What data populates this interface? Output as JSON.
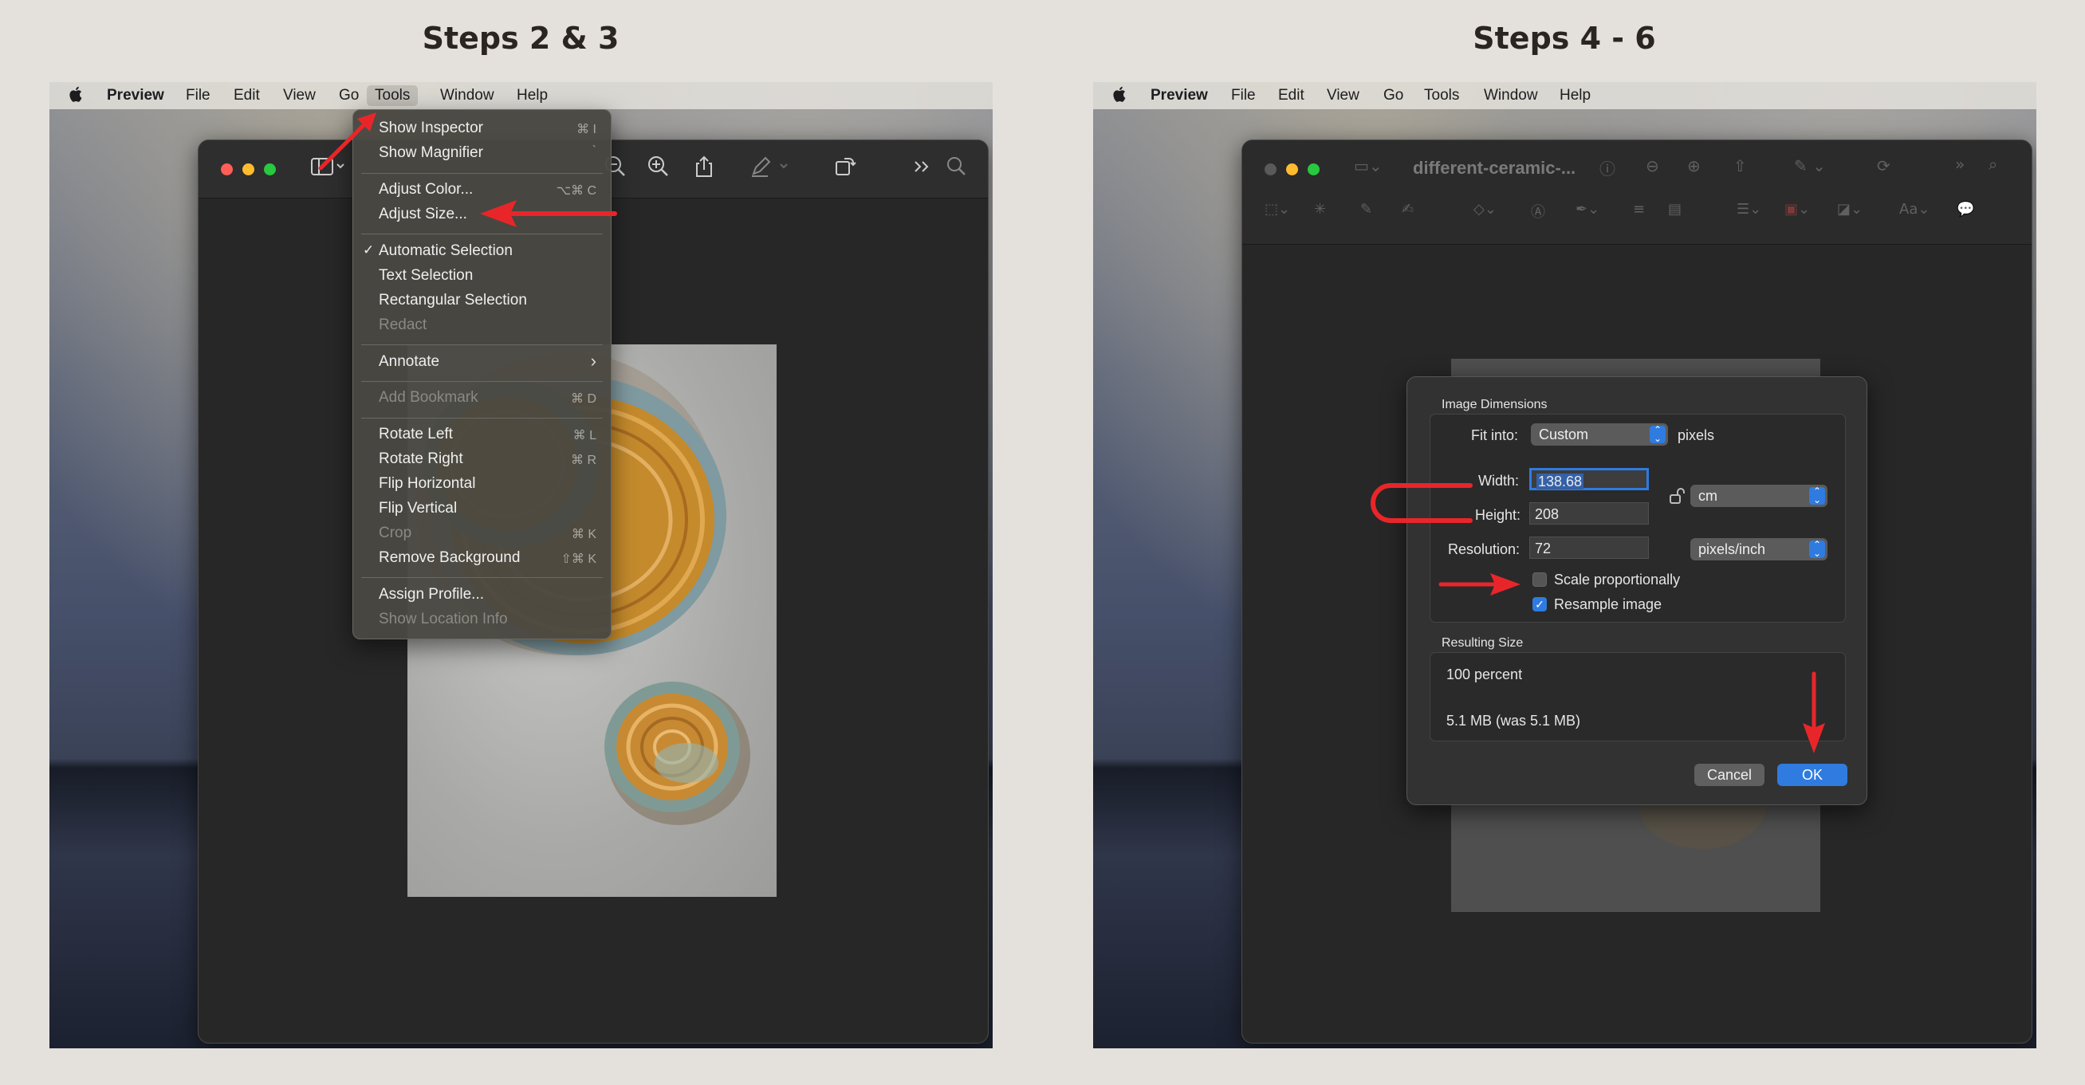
{
  "left": {
    "title": "Steps 2 & 3",
    "menubar": {
      "apple": "",
      "app": "Preview",
      "items": [
        "File",
        "Edit",
        "View",
        "Go",
        "Tools",
        "Window",
        "Help"
      ]
    },
    "toolbar_icons": [
      "sidebar-icon",
      "zoom-out-icon",
      "zoom-in-icon",
      "share-icon",
      "markup-icon",
      "rotate-icon",
      "more-icon",
      "search-icon"
    ],
    "tools_menu": {
      "items": [
        {
          "label": "Show Inspector",
          "shortcut": "⌘ I",
          "disabled": false
        },
        {
          "label": "Show Magnifier",
          "shortcut": "`",
          "disabled": false
        },
        {
          "label": "Adjust Color...",
          "shortcut": "⌥⌘ C",
          "disabled": false
        },
        {
          "label": "Adjust Size...",
          "shortcut": "",
          "disabled": false
        },
        {
          "label": "Automatic Selection",
          "shortcut": "",
          "disabled": false,
          "checked": true
        },
        {
          "label": "Text Selection",
          "shortcut": "",
          "disabled": false
        },
        {
          "label": "Rectangular Selection",
          "shortcut": "",
          "disabled": false
        },
        {
          "label": "Redact",
          "shortcut": "",
          "disabled": true
        },
        {
          "label": "Annotate",
          "shortcut": "›",
          "disabled": false
        },
        {
          "label": "Add Bookmark",
          "shortcut": "⌘ D",
          "disabled": true
        },
        {
          "label": "Rotate Left",
          "shortcut": "⌘ L",
          "disabled": false
        },
        {
          "label": "Rotate Right",
          "shortcut": "⌘ R",
          "disabled": false
        },
        {
          "label": "Flip Horizontal",
          "shortcut": "",
          "disabled": false
        },
        {
          "label": "Flip Vertical",
          "shortcut": "",
          "disabled": false
        },
        {
          "label": "Crop",
          "shortcut": "⌘ K",
          "disabled": true
        },
        {
          "label": "Remove Background",
          "shortcut": "⇧⌘ K",
          "disabled": false
        },
        {
          "label": "Assign Profile...",
          "shortcut": "",
          "disabled": false
        },
        {
          "label": "Show Location Info",
          "shortcut": "",
          "disabled": true
        }
      ]
    }
  },
  "right": {
    "title": "Steps 4 - 6",
    "menubar": {
      "app": "Preview",
      "items": [
        "File",
        "Edit",
        "View",
        "Go",
        "Tools",
        "Window",
        "Help"
      ]
    },
    "window_title": "different-ceramic-...",
    "dialog": {
      "section1": "Image Dimensions",
      "fit_label": "Fit into:",
      "fit_value": "Custom",
      "fit_unit": "pixels",
      "width_label": "Width:",
      "width_value": "138.68",
      "height_label": "Height:",
      "height_value": "208",
      "unit_value": "cm",
      "resolution_label": "Resolution:",
      "resolution_value": "72",
      "resolution_unit": "pixels/inch",
      "scale_label": "Scale proportionally",
      "scale_checked": false,
      "resample_label": "Resample image",
      "resample_checked": true,
      "section2": "Resulting Size",
      "percent": "100 percent",
      "size": "5.1 MB (was 5.1 MB)",
      "cancel": "Cancel",
      "ok": "OK"
    }
  },
  "colors": {
    "accent": "#2f7be0",
    "arrow": "#e8262a"
  }
}
